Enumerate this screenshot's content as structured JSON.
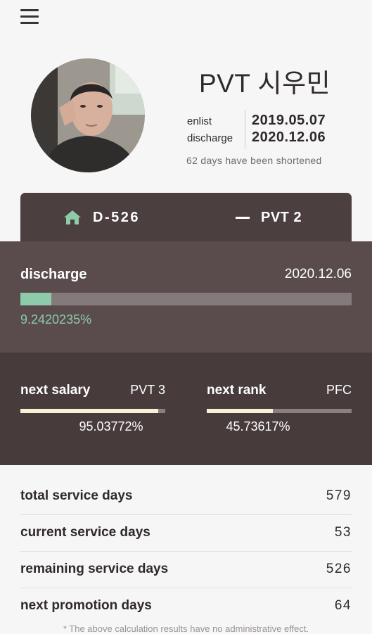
{
  "profile": {
    "name": "PVT 시우민",
    "enlist_label": "enlist",
    "enlist_date": "2019.05.07",
    "discharge_label": "discharge",
    "discharge_date": "2020.12.06",
    "shortened_text": "62 days have been shortened"
  },
  "tabs": {
    "dday": "D-526",
    "rank": "PVT 2"
  },
  "discharge": {
    "label": "discharge",
    "date": "2020.12.06",
    "percent_text": "9.2420235%",
    "progress": 0.092420235
  },
  "next_salary": {
    "label": "next salary",
    "rank": "PVT 3",
    "percent_text": "95.03772%",
    "progress": 0.9503772
  },
  "next_rank": {
    "label": "next rank",
    "rank": "PFC",
    "percent_text": "45.73617%",
    "progress": 0.4573617
  },
  "stats": [
    {
      "label": "total service days",
      "value": "579"
    },
    {
      "label": "current service days",
      "value": "53"
    },
    {
      "label": "remaining service days",
      "value": "526"
    },
    {
      "label": "next promotion days",
      "value": "64"
    }
  ],
  "footnote": "* The above calculation results have no administrative effect.",
  "colors": {
    "accent": "#8ecbaa",
    "tab_bg": "#4b3f40",
    "discharge_bg": "#5a4c4d",
    "next_bg": "#473b3c",
    "bar_light": "#f6f1d4"
  },
  "icons": {
    "menu": "hamburger-menu-icon",
    "home": "house-icon",
    "rank": "minus-stripe-icon"
  }
}
